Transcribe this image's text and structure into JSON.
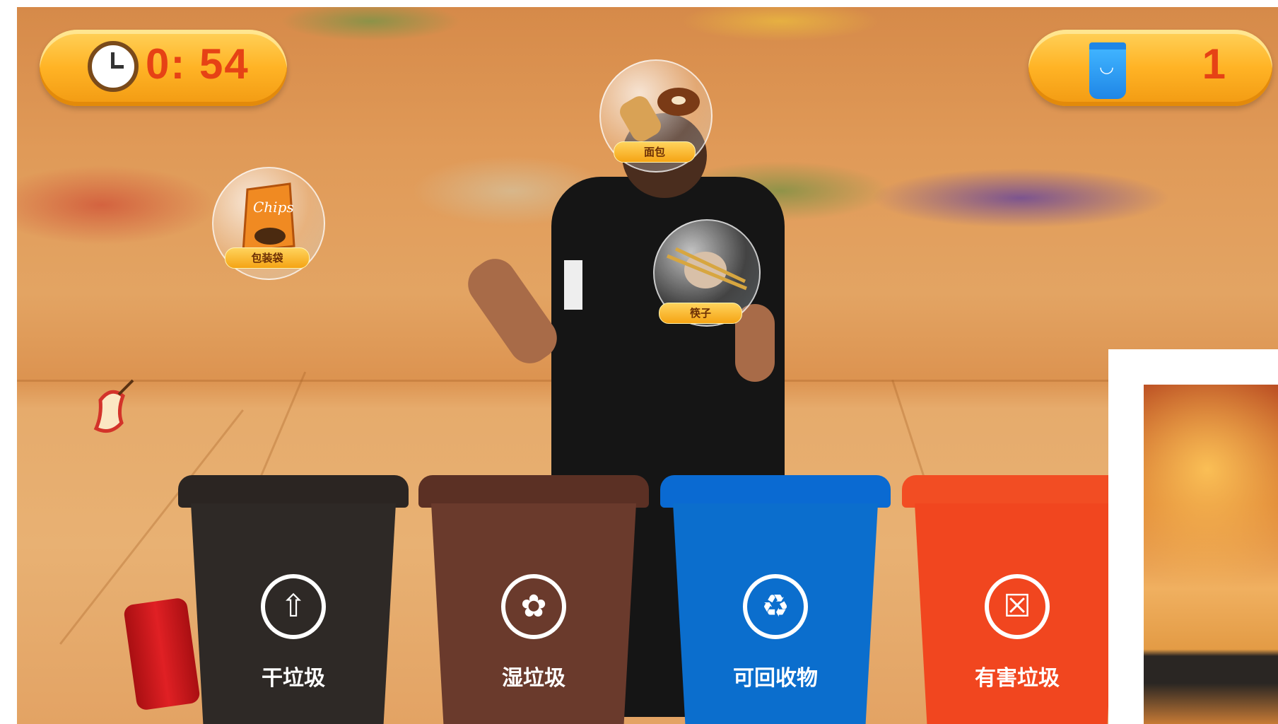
{
  "hud": {
    "timer": "0: 54",
    "score": "1",
    "timer_icon": "alarm-clock-icon",
    "score_icon": "smiling-trash-bin-icon"
  },
  "items": [
    {
      "label": "面包",
      "icon": "bread-donut-icon"
    },
    {
      "label": "包装袋",
      "icon": "chips-bag-icon"
    },
    {
      "label": "筷子",
      "icon": "chopsticks-icon"
    }
  ],
  "bins": [
    {
      "label": "干垃圾",
      "color": "#2e2926",
      "icon": "dry-waste-icon"
    },
    {
      "label": "湿垃圾",
      "color": "#6a3a2c",
      "icon": "wet-waste-icon"
    },
    {
      "label": "可回收物",
      "color": "#0b6ecd",
      "icon": "recycle-icon"
    },
    {
      "label": "有害垃圾",
      "color": "#f1461f",
      "icon": "hazardous-waste-icon"
    }
  ]
}
